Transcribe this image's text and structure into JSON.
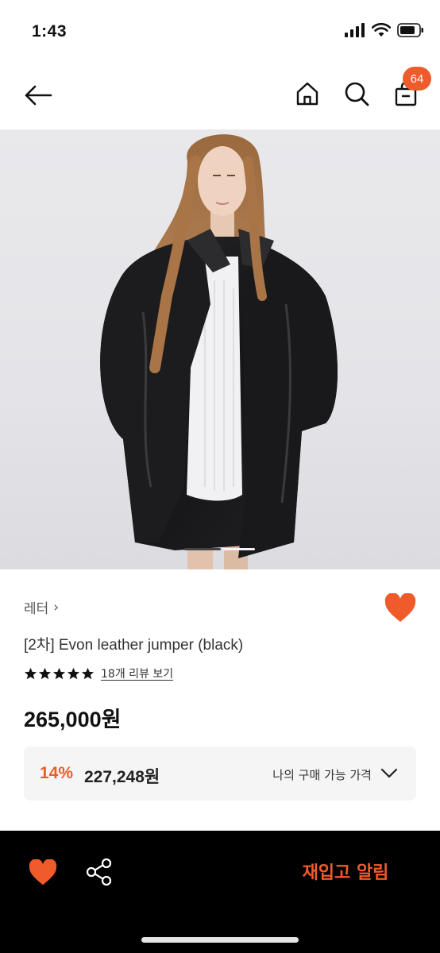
{
  "status": {
    "time": "1:43"
  },
  "nav": {
    "cart_count": "64"
  },
  "gallery": {
    "current_index": 1,
    "total": 2
  },
  "product": {
    "brand": "레터",
    "brand_arrow": "›",
    "title": "[2차] Evon leather jumper (black)",
    "rating": 5,
    "review_link": "18개 리뷰 보기",
    "price": "265,000원",
    "discount_rate": "14%",
    "discount_price": "227,248원",
    "my_price_label": "나의 구매 가능 가격"
  },
  "bottom": {
    "restock_label": "재입고 알림"
  },
  "colors": {
    "accent": "#ef5b2a",
    "bottom_bar": "#000000",
    "discount_bg": "#f5f5f6"
  },
  "icons": [
    "back-arrow-icon",
    "home-icon",
    "search-icon",
    "shopping-bag-icon",
    "heart-icon",
    "star-icon",
    "chevron-down-icon",
    "share-icon"
  ]
}
